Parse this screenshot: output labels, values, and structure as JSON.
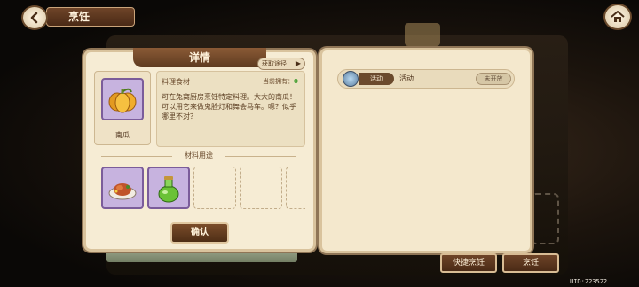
{
  "header": {
    "title": "烹饪"
  },
  "detail": {
    "title": "详情",
    "acquire_label": "获取途径",
    "item": {
      "name": "南瓜",
      "type": "料理食材",
      "owned_label": "当前拥有：",
      "owned_count": "0",
      "description": "可在兔窝厨房烹饪特定料理。大大的南瓜！可以用它来做鬼脸灯和舞会马车。嗯？似乎哪里不对？"
    },
    "usage_title": "材料用途",
    "usage_slots": [
      {
        "icon": "roasted-dish-icon",
        "filled": true
      },
      {
        "icon": "green-potion-icon",
        "filled": true
      },
      {
        "filled": false
      },
      {
        "filled": false
      },
      {
        "filled": false
      }
    ],
    "confirm_label": "确认"
  },
  "sources": [
    {
      "tag": "活动",
      "name": "活动",
      "status": "未开放",
      "icon": "fish-icon"
    }
  ],
  "footer": {
    "quick_cook_label": "快捷烹饪",
    "cook_label": "烹饪",
    "uid_text": "UID:223522"
  },
  "colors": {
    "panel_bg": "#f6ecd4",
    "header_brown": "#6b4a2d",
    "slot_purple": "#c7b3df",
    "owned_green": "#3d9c2b"
  }
}
